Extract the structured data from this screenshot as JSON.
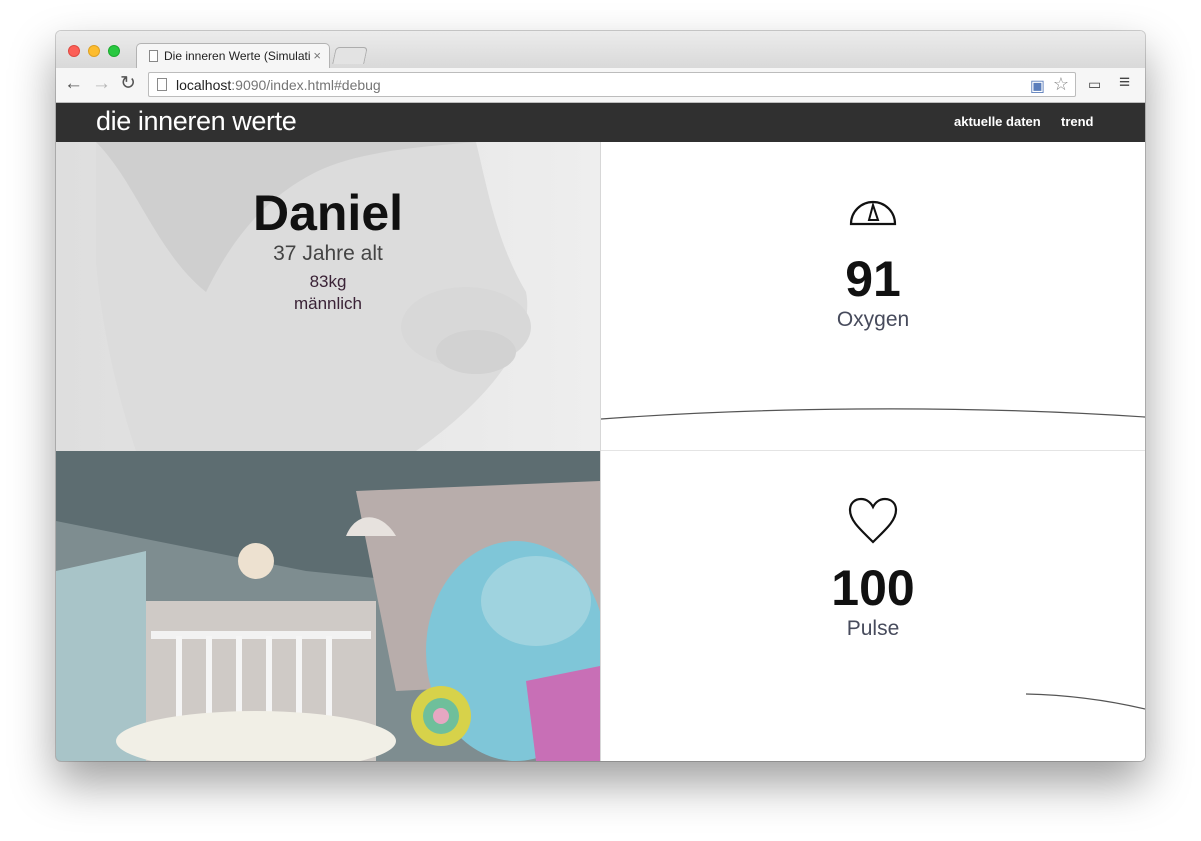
{
  "browser": {
    "tab_title": "Die inneren Werte (Simulati",
    "tab_close": "×",
    "url_host": "localhost",
    "url_rest": ":9090/index.html#debug"
  },
  "navbar": {
    "brand": "die inneren werte",
    "links": [
      "aktuelle daten",
      "trend"
    ]
  },
  "profile": {
    "name": "Daniel",
    "age": "37 Jahre alt",
    "weight": "83kg",
    "sex": "männlich"
  },
  "metrics": {
    "oxygen": {
      "value": "91",
      "label": "Oxygen",
      "icon": "gauge-icon"
    },
    "pulse": {
      "value": "100",
      "label": "Pulse",
      "icon": "heart-icon"
    }
  },
  "colors": {
    "navbar": "#303030",
    "text": "#111111",
    "label": "#474b5c"
  }
}
